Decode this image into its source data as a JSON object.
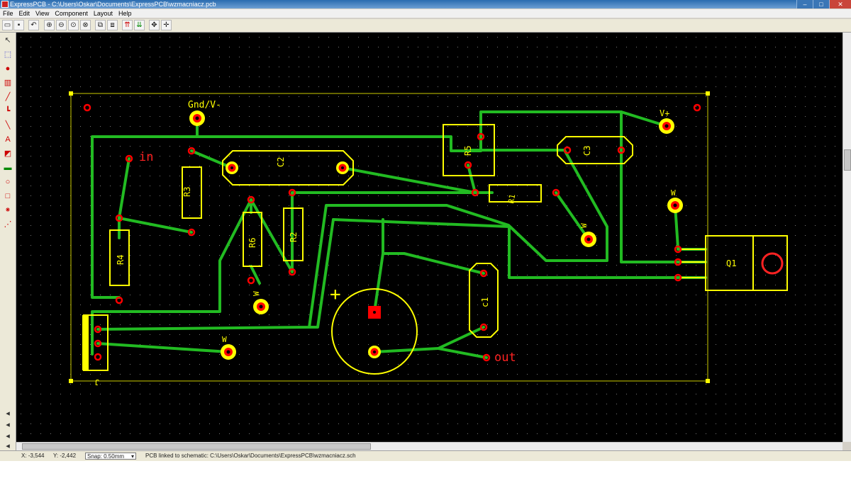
{
  "window": {
    "title": "ExpressPCB - C:\\Users\\Oskar\\Documents\\ExpressPCB\\wzmacniacz.pcb"
  },
  "menu": [
    "File",
    "Edit",
    "View",
    "Component",
    "Layout",
    "Help"
  ],
  "toolbar_icons": [
    "open-icon",
    "save-icon",
    "undo-icon",
    "zoom-in-icon",
    "zoom-out-icon",
    "zoom-fit-icon",
    "zoom-area-icon",
    "layer-top-icon",
    "layer-bottom-icon",
    "show-top-icon",
    "show-bottom-icon",
    "pan-icon",
    "center-icon"
  ],
  "left_tools": [
    "select-tool",
    "select-area-tool",
    "pad-tool",
    "component-tool",
    "trace-tool",
    "angle-trace-tool",
    "diag-trace-tool",
    "text-tool",
    "fill-tool",
    "pcb-tool",
    "circle-tool",
    "rect-tool",
    "net-tool",
    "rats-tool"
  ],
  "status": {
    "x": "X: -3,544",
    "y": "Y: -2,442",
    "snap": "Snap: 0.50mm",
    "linked": "PCB linked to schematic: C:\\Users\\Oskar\\Documents\\ExpressPCB\\wzmacniacz.sch"
  },
  "pcb": {
    "labels": {
      "gnd": "Gnd/V-",
      "vplus": "V+",
      "in": "in",
      "out": "out",
      "plus": "+",
      "w": "W",
      "j": "J"
    },
    "components": {
      "r1": "R1",
      "r2": "R2",
      "r3": "R3",
      "r4": "R4",
      "r5": "R5",
      "r6": "R6",
      "c1": "c1",
      "c2": "C2",
      "c3": "C3",
      "q1": "Q1"
    },
    "colors": {
      "trace": "#22bb22",
      "silk": "#ffff00",
      "pad": "#ff0000",
      "board_bg": "#000000",
      "red_text": "#ff2222"
    }
  }
}
